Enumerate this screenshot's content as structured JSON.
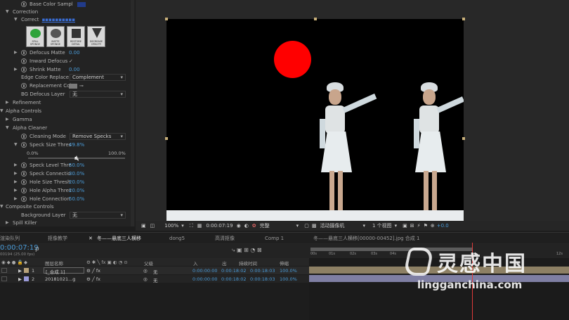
{
  "effects": {
    "base_color_label": "Base Color Sampl",
    "correction_label": "Correction",
    "correct_label": "Correct",
    "buttons": [
      "SPILL SPONGE",
      "MATTE SPONGE",
      "RESTORE DETAIL",
      "DECREASE OPACITY"
    ],
    "defocus_matte": {
      "label": "Defocus Matte",
      "value": "0.00"
    },
    "inward_defocus": {
      "label": "Inward Defocus",
      "value": "✓"
    },
    "shrink_matte": {
      "label": "Shrink Matte",
      "value": "0.00"
    },
    "edge_color_replace": {
      "label": "Edge Color Replace",
      "value": "Complement"
    },
    "replacement_col": {
      "label": "Replacement Col"
    },
    "bg_defocus_layer": {
      "label": "BG Defocus Layer",
      "value": "无"
    },
    "refinement_label": "Refinement",
    "alpha_controls_label": "Alpha Controls",
    "gamma_label": "Gamma",
    "alpha_cleaner_label": "Alpha Cleaner",
    "cleaning_mode": {
      "label": "Cleaning Mode",
      "value": "Remove Specks"
    },
    "speck_size_thres": {
      "label": "Speck Size Thres",
      "value": "49.8%",
      "min": "0.0%",
      "max": "100.0%",
      "level": 0.498
    },
    "speck_level_thre": {
      "label": "Speck Level Thre",
      "value": "50.0%"
    },
    "speck_connection": {
      "label": "Speck Connectio",
      "value": "30.0%"
    },
    "hole_size_thresh": {
      "label": "Hole Size Thresh",
      "value": "20.0%"
    },
    "hole_alpha_thres": {
      "label": "Hole Alpha Thres",
      "value": "20.0%"
    },
    "hole_connection": {
      "label": "Hole Connection",
      "value": "50.0%"
    },
    "composite_controls_label": "Composite Controls",
    "background_layer": {
      "label": "Background Layer",
      "value": "无"
    },
    "spill_killer_label": "Spill Killer"
  },
  "viewer": {
    "zoom": "100%",
    "timecode": "0:00:07:19",
    "quality": "完整",
    "camera": "活动摄像机",
    "views": "1 个视图",
    "exposure": "+0.0"
  },
  "tabs": [
    "渲染队列",
    "抠像教学",
    "冬——悬底三人横移",
    "dong5",
    "高清抠像",
    "Comp 1",
    "冬——悬底三人横移[00000-00452].jpg 合成 1"
  ],
  "timeline": {
    "current_time": "0:00:07:19",
    "fps": "00194 (25.00 fps)",
    "columns": {
      "name": "图层名称",
      "parent": "父级",
      "in": "入",
      "out": "出",
      "duration": "持续时间",
      "stretch": "伸缩"
    },
    "layers": [
      {
        "index": "1",
        "name": "[_合成 1]",
        "parent": "无",
        "in": "0:00:00:00",
        "out": "0:00:18:02",
        "duration": "0:00:18:03",
        "stretch": "100.0%"
      },
      {
        "index": "2",
        "name": "20181021...g",
        "parent": "无",
        "in": "0:00:00:00",
        "out": "0:00:18:02",
        "duration": "0:00:18:03",
        "stretch": "100.0%"
      }
    ],
    "ruler": [
      "00s",
      "01s",
      "02s",
      "03s",
      "04s",
      "12s"
    ]
  },
  "watermark": {
    "brand": "灵感中国",
    "url": "lingganchina.com"
  },
  "colors": {
    "accent": "#4a9bd8",
    "moon": "#ff0000",
    "playhead": "#e03b3b"
  }
}
